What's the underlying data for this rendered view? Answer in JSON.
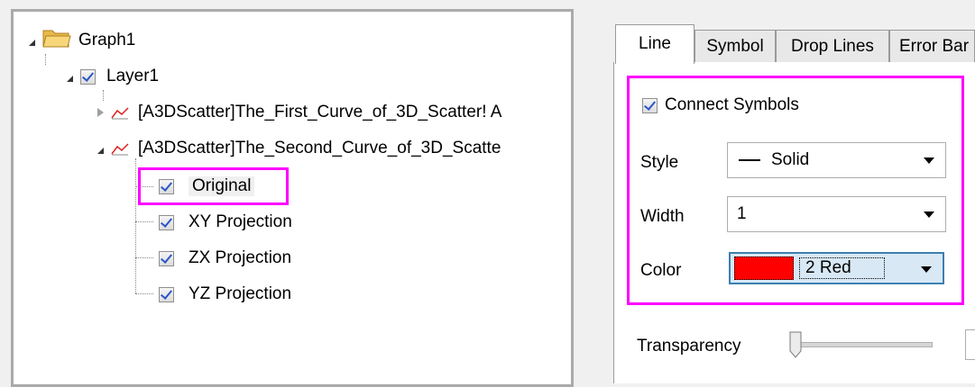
{
  "tree": {
    "root": "Graph1",
    "layer": "Layer1",
    "curve1": "[A3DScatter]The_First_Curve_of_3D_Scatter! A",
    "curve2": "[A3DScatter]The_Second_Curve_of_3D_Scatte",
    "children": [
      "Original",
      "XY Projection",
      "ZX Projection",
      "YZ Projection"
    ]
  },
  "tabs": [
    "Line",
    "Symbol",
    "Drop Lines",
    "Error Bar"
  ],
  "line_tab": {
    "connect_symbols": "Connect Symbols",
    "style_label": "Style",
    "style_value": "Solid",
    "width_label": "Width",
    "width_value": "1",
    "color_label": "Color",
    "color_value": "2 Red",
    "color_swatch": "#ff0000",
    "transparency_label": "Transparency"
  },
  "highlight_color": "#ff00ff"
}
